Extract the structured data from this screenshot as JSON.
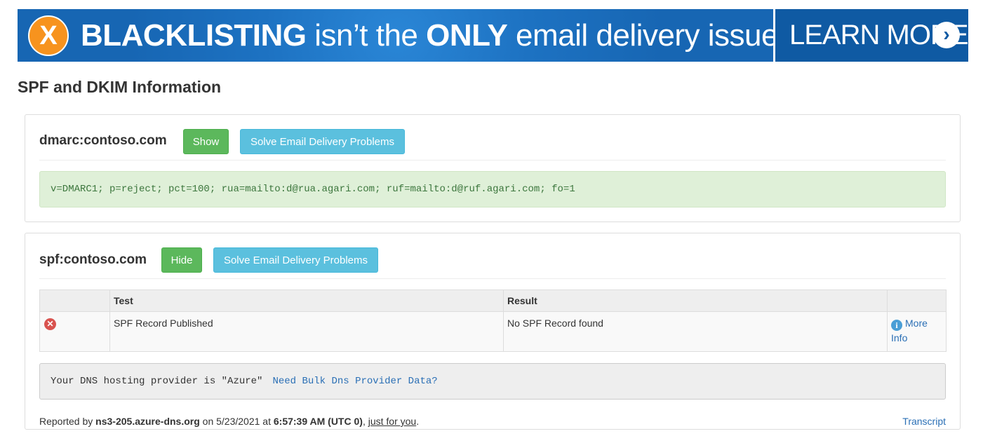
{
  "banner": {
    "x_glyph": "X",
    "headline_bold_1": "BLACKLISTING",
    "headline_mid": " isn’t the ",
    "headline_bold_2": "ONLY",
    "headline_end": " email delivery issue",
    "cta": "LEARN MORE",
    "cta_arrow": "›"
  },
  "page_title": "SPF and DKIM Information",
  "dmarc": {
    "name": "dmarc:contoso.com",
    "show_label": "Show",
    "solve_label": "Solve Email Delivery Problems",
    "record": "v=DMARC1; p=reject; pct=100; rua=mailto:d@rua.agari.com; ruf=mailto:d@ruf.agari.com; fo=1"
  },
  "spf": {
    "name": "spf:contoso.com",
    "hide_label": "Hide",
    "solve_label": "Solve Email Delivery Problems",
    "table": {
      "headers": [
        "",
        "Test",
        "Result",
        ""
      ],
      "rows": [
        {
          "status_icon": "error-icon",
          "test": "SPF Record Published",
          "result": "No SPF Record found",
          "info_glyph": "i",
          "more_info": "More Info"
        }
      ]
    },
    "dns_provider_text": "Your DNS hosting provider is \"Azure\"",
    "dns_bulk_link": "Need Bulk Dns Provider Data?",
    "footer": {
      "reported_by_prefix": "Reported by ",
      "server": "ns3-205.azure-dns.org",
      "on_text": " on 5/23/2021 at ",
      "time": "6:57:39 AM (UTC 0)",
      "comma": ", ",
      "just_for_you": "just for you",
      "period": ".",
      "transcript": "Transcript"
    }
  },
  "colors": {
    "banner_blue": "#1766b3",
    "btn_green": "#5cb85c",
    "btn_blue": "#5bc0de",
    "record_bg": "#dff0d8",
    "link": "#2a6fb5",
    "error": "#d9534f"
  }
}
